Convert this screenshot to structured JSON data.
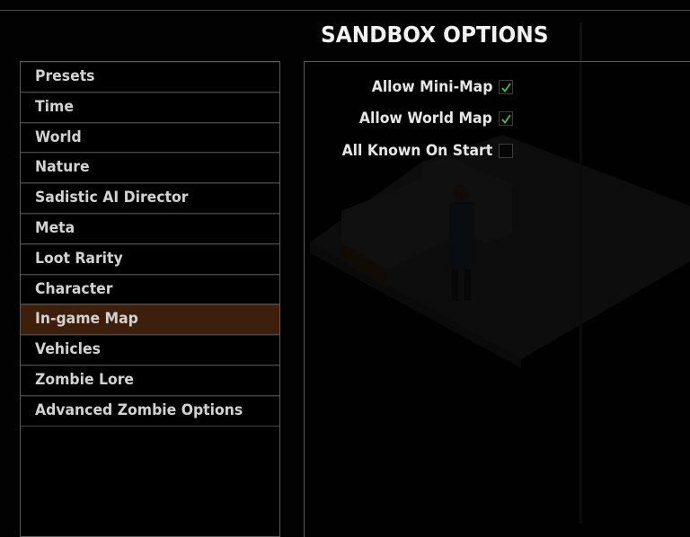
{
  "header": {
    "title": "SANDBOX OPTIONS"
  },
  "sidebar": {
    "selected_index": 8,
    "items": [
      {
        "label": "Presets"
      },
      {
        "label": "Time"
      },
      {
        "label": "World"
      },
      {
        "label": "Nature"
      },
      {
        "label": "Sadistic AI Director"
      },
      {
        "label": "Meta"
      },
      {
        "label": "Loot Rarity"
      },
      {
        "label": "Character"
      },
      {
        "label": "In-game Map"
      },
      {
        "label": "Vehicles"
      },
      {
        "label": "Zombie Lore"
      },
      {
        "label": "Advanced Zombie Options"
      }
    ]
  },
  "options": [
    {
      "label": "Allow Mini-Map",
      "checked": true,
      "icon": "check-icon"
    },
    {
      "label": "Allow World Map",
      "checked": true,
      "icon": "check-icon"
    },
    {
      "label": "All Known On Start",
      "checked": false,
      "icon": ""
    }
  ],
  "colors": {
    "selected_row": "#3e1f0c",
    "checkmark": "#3fbf4a",
    "panel_border": "#5a5a5a"
  }
}
